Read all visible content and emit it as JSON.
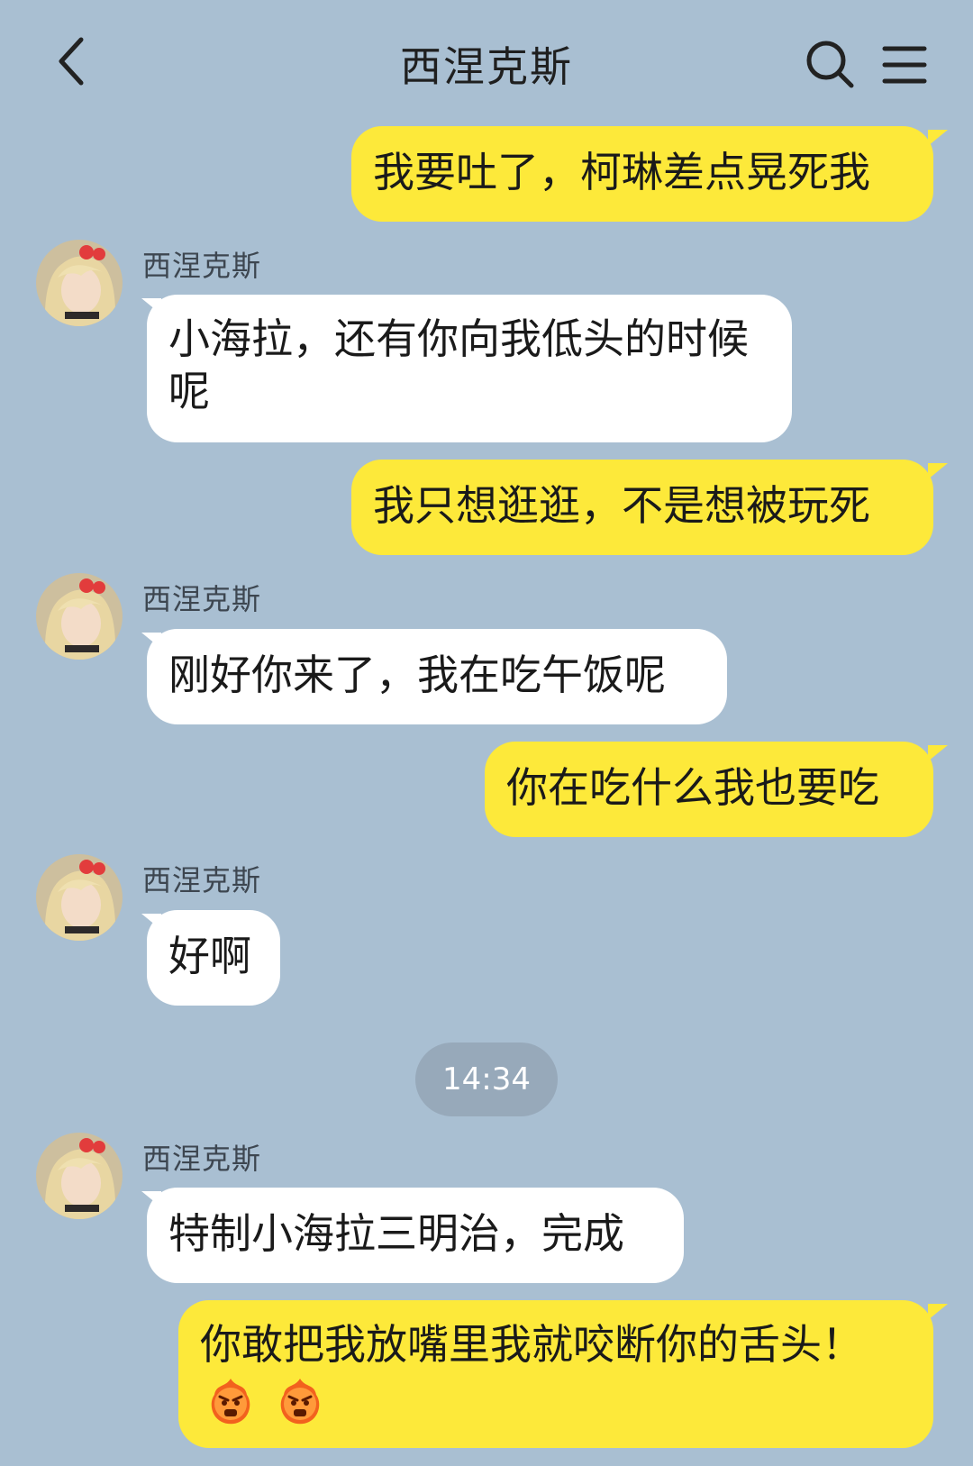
{
  "header": {
    "title": "西涅克斯",
    "back_icon": "chevron-left-icon",
    "search_icon": "search-icon",
    "menu_icon": "hamburger-menu-icon"
  },
  "colors": {
    "background": "#a9bfd2",
    "outgoing_bubble": "#fde93a",
    "incoming_bubble": "#ffffff",
    "timestamp_pill": "#97a9ba"
  },
  "messages": [
    {
      "direction": "out",
      "text": "我要吐了，柯琳差点晃死我"
    },
    {
      "direction": "in",
      "sender": "西涅克斯",
      "text": "小海拉，还有你向我低头的时候呢"
    },
    {
      "direction": "out",
      "text": "我只想逛逛，不是想被玩死"
    },
    {
      "direction": "in",
      "sender": "西涅克斯",
      "text": "刚好你来了，我在吃午饭呢"
    },
    {
      "direction": "out",
      "text": "你在吃什么我也要吃"
    },
    {
      "direction": "in",
      "sender": "西涅克斯",
      "text": "好啊"
    },
    {
      "direction": "time",
      "text": "14:34"
    },
    {
      "direction": "in",
      "sender": "西涅克斯",
      "text": "特制小海拉三明治，完成"
    },
    {
      "direction": "out",
      "text": "你敢把我放嘴里我就咬断你的舌头！",
      "emojis": [
        "angry-fire-face-emoji",
        "angry-fire-face-emoji"
      ]
    }
  ]
}
